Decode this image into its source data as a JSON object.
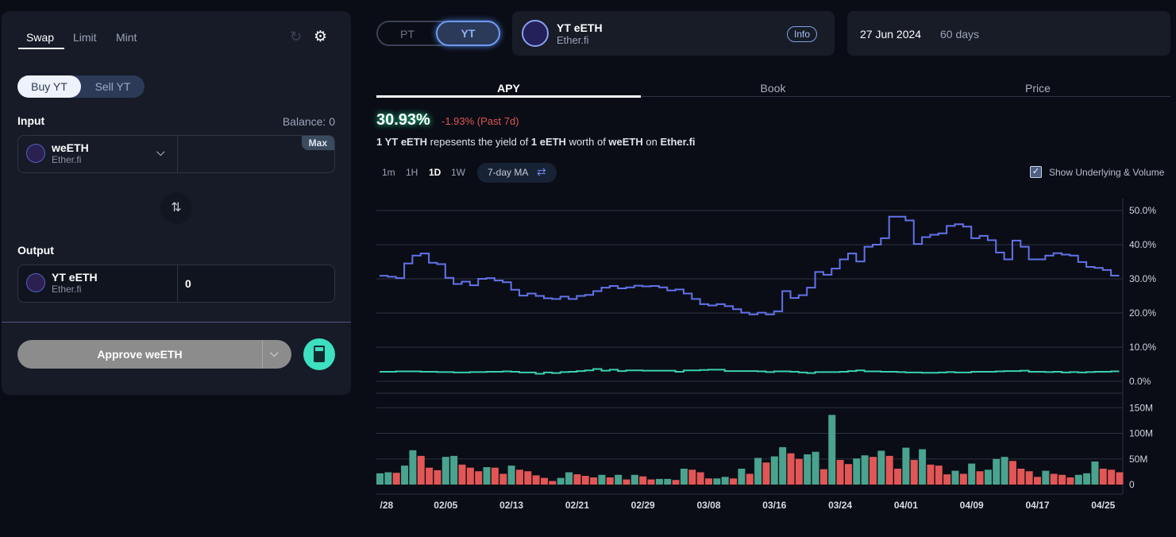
{
  "swap_panel": {
    "tabs": [
      "Swap",
      "Limit",
      "Mint"
    ],
    "mode": [
      "Buy YT",
      "Sell YT"
    ],
    "input_label": "Input",
    "balance": "Balance: 0",
    "input_token": {
      "name": "weETH",
      "sub": "Ether.fi"
    },
    "max": "Max",
    "output_label": "Output",
    "output_token": {
      "name": "YT eETH",
      "sub": "Ether.fi"
    },
    "output_value": "0",
    "approve": "Approve weETH",
    "icons": [
      "refresh-icon",
      "gear-icon",
      "swap-arrows-icon",
      "chevron-down-icon",
      "calculator-icon"
    ]
  },
  "header": {
    "toggle": [
      "PT",
      "YT"
    ],
    "asset": {
      "name": "YT eETH",
      "sub": "Ether.fi",
      "info": "Info"
    },
    "maturity": {
      "date": "27 Jun 2024",
      "days": "60 days"
    }
  },
  "chart_tabs": [
    "APY",
    "Book",
    "Price"
  ],
  "summary": {
    "apy": "30.93%",
    "change": "-1.93% (Past 7d)",
    "desc": [
      "1 YT eETH",
      " repesents the yield of ",
      "1 eETH",
      " worth of ",
      "weETH",
      " on ",
      "Ether.fi"
    ]
  },
  "ranges": [
    "1m",
    "1H",
    "1D",
    "1W"
  ],
  "active_range": "1D",
  "ma": "7-day MA",
  "show_underlying": {
    "label": "Show Underlying & Volume",
    "checked": true
  },
  "colors": {
    "apy": "#6272ea",
    "underlying": "#3ad1b0",
    "up": "#4aa38e",
    "down": "#e25656",
    "accent": "#3de0c0"
  },
  "chart_data": [
    {
      "type": "line",
      "ylim": [
        0,
        50
      ],
      "yticks": [
        "50.0%",
        "40.0%",
        "30.0%",
        "20.0%",
        "10.0%",
        "0.0%"
      ],
      "grid": true,
      "step": true,
      "series": [
        {
          "values": [
            30.9,
            30.6,
            30.2,
            34.5,
            36.8,
            37.4,
            34.7,
            34.3,
            30.3,
            28.5,
            29.2,
            28.1,
            30.0,
            30.2,
            29.5,
            29.0,
            26.8,
            25.1,
            25.7,
            25.0,
            24.3,
            24.1,
            24.8,
            24.1,
            25.0,
            25.3,
            26.4,
            27.4,
            27.9,
            27.2,
            27.5,
            28.0,
            27.8,
            27.9,
            27.5,
            26.6,
            26.9,
            25.7,
            24.1,
            22.6,
            22.2,
            22.6,
            22.0,
            21.1,
            20.1,
            19.6,
            20.1,
            19.6,
            20.5,
            26.4,
            24.4,
            25.2,
            27.4,
            32.0,
            31.2,
            33.0,
            35.7,
            37.4,
            35.1,
            39.4,
            40.0,
            41.9,
            48.2,
            48.2,
            47.1,
            40.2,
            42.2,
            42.9,
            43.3,
            45.5,
            46.0,
            45.3,
            41.9,
            42.6,
            41.3,
            37.7,
            35.7,
            41.2,
            39.4,
            35.7,
            35.7,
            36.8,
            37.5,
            37.1,
            36.8,
            34.9,
            33.5,
            33.2,
            32.6,
            30.93
          ]
        },
        {
          "values": [
            2.8,
            2.8,
            2.9,
            2.9,
            2.9,
            2.8,
            2.8,
            2.7,
            2.7,
            2.6,
            2.6,
            2.7,
            2.7,
            2.8,
            2.8,
            2.9,
            2.8,
            2.6,
            2.6,
            2.2,
            2.6,
            2.4,
            2.7,
            2.8,
            3.0,
            3.2,
            3.6,
            3.1,
            3.4,
            3.0,
            3.2,
            3.2,
            3.1,
            3.1,
            3.1,
            3.1,
            2.8,
            3.2,
            3.2,
            3.3,
            3.4,
            3.4,
            3.0,
            3.0,
            3.0,
            3.0,
            2.9,
            2.7,
            2.9,
            2.9,
            2.8,
            2.6,
            2.4,
            2.7,
            2.7,
            2.7,
            2.8,
            3.0,
            3.2,
            2.9,
            2.9,
            2.8,
            2.8,
            2.7,
            2.6,
            2.6,
            2.5,
            2.5,
            2.6,
            2.7,
            2.6,
            2.6,
            2.8,
            2.8,
            2.8,
            2.9,
            3.0,
            3.0,
            3.1,
            2.8,
            2.8,
            2.7,
            2.8,
            2.6,
            2.7,
            2.6,
            2.7,
            2.8,
            2.8,
            2.9
          ]
        }
      ]
    },
    {
      "type": "bar",
      "ylim": [
        0,
        160
      ],
      "yticks": [
        "150M",
        "100M",
        "50M",
        "0"
      ],
      "tick_values": [
        150,
        100,
        50,
        0
      ],
      "unit": "M",
      "xticks": [
        "/28",
        "02/05",
        "02/13",
        "02/21",
        "02/29",
        "03/08",
        "03/16",
        "03/24",
        "04/01",
        "04/09",
        "04/17",
        "04/25"
      ],
      "values": [
        22,
        24,
        23,
        37,
        67,
        56,
        33,
        28,
        54,
        56,
        39,
        33,
        26,
        34,
        33,
        21,
        37,
        29,
        26,
        18,
        13,
        7,
        13,
        24,
        20,
        17,
        14,
        19,
        14,
        19,
        10,
        19,
        16,
        10,
        11,
        11,
        9,
        31,
        29,
        24,
        12,
        12,
        15,
        12,
        31,
        21,
        52,
        43,
        55,
        73,
        61,
        50,
        59,
        64,
        30,
        136,
        48,
        40,
        51,
        57,
        54,
        66,
        56,
        31,
        72,
        48,
        69,
        39,
        37,
        20,
        27,
        21,
        41,
        26,
        29,
        50,
        54,
        46,
        31,
        26,
        15,
        27,
        21,
        19,
        14,
        19,
        22,
        45,
        31,
        29,
        24
      ],
      "direction": "GGRGGRRRGGRRRGRRGRRRRRGGRRRGRGRGRRGGRGRRRGGRGRGRGGRRGGRGRRGGRGRRGRGRRRGRGRGGGRRRRGRRRGGGRRR"
    }
  ]
}
